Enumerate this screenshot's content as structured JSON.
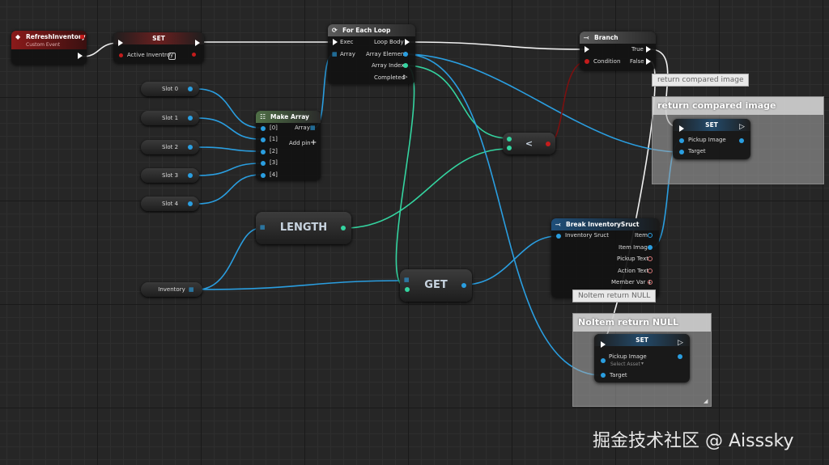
{
  "colors": {
    "exec": "#ffffff",
    "object": "#2a9ee0",
    "integer": "#34d4a0",
    "boolean": "#c41c1c",
    "event": "#8a1a1a",
    "background": "#262626"
  },
  "event": {
    "title": "RefreshInventory",
    "subtitle": "Custom Event",
    "icon": "event-diamond-icon"
  },
  "set1": {
    "title": "SET",
    "pin": "Active Inventroy"
  },
  "foreach": {
    "title": "For Each Loop",
    "exec": "Exec",
    "array": "Array",
    "loop_body": "Loop Body",
    "array_element": "Array Element",
    "array_index": "Array Index",
    "completed": "Completed",
    "icon": "loop-icon"
  },
  "branch": {
    "title": "Branch",
    "true": "True",
    "false": "False",
    "condition": "Condition",
    "icon": "branch-icon"
  },
  "slots": [
    "Slot 0",
    "Slot 1",
    "Slot 2",
    "Slot 3",
    "Slot 4"
  ],
  "make_array": {
    "title": "Make Array",
    "inputs": [
      "[0]",
      "[1]",
      "[2]",
      "[3]",
      "[4]"
    ],
    "array": "Array",
    "add_pin": "Add pin"
  },
  "length": {
    "title": "LENGTH"
  },
  "inventory": {
    "label": "Inventory"
  },
  "get": {
    "title": "GET"
  },
  "less": {
    "symbol": "<"
  },
  "comment1": {
    "title": "return compared image",
    "bubble": "return compared image"
  },
  "set2": {
    "title": "SET",
    "pickup_image": "Pickup Image",
    "target": "Target"
  },
  "break_struct": {
    "title": "Break InventorySruct",
    "input": "Inventory Sruct",
    "outputs": [
      "Item",
      "Item Image",
      "Pickup Text",
      "Action Text",
      "Member Var 4"
    ]
  },
  "comment2": {
    "title": "NoItem return NULL",
    "bubble": "NoItem return NULL"
  },
  "set3": {
    "title": "SET",
    "pickup_image": "Pickup Image",
    "select_asset": "Select Asset",
    "target": "Target"
  },
  "watermark": "掘金技术社区 @ Aisssky"
}
